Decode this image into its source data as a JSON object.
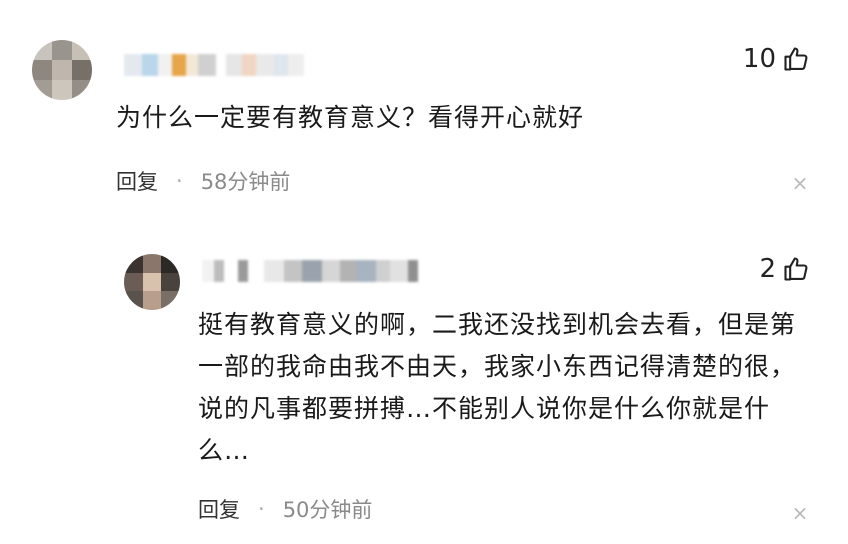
{
  "comments": [
    {
      "likes": "10",
      "text": "为什么一定要有教育意义？看得开心就好",
      "reply_label": "回复",
      "separator": "·",
      "time": "58分钟前",
      "close_glyph": "×"
    },
    {
      "likes": "2",
      "text": "挺有教育意义的啊，二我还没找到机会去看，但是第一部的我命由我不由天，我家小东西记得清楚的很，说的凡事都要拼搏…不能别人说你是什么你就是什么…",
      "reply_label": "回复",
      "separator": "·",
      "time": "50分钟前",
      "close_glyph": "×"
    }
  ],
  "icons": {
    "like": "thumbs-up-icon",
    "close": "close-icon"
  },
  "colors": {
    "text": "#1a1a1a",
    "meta": "#8a8a8a",
    "close": "#b8b8b8",
    "background": "#ffffff"
  }
}
